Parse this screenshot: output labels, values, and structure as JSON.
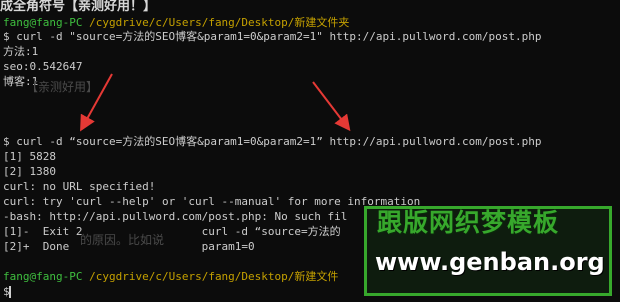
{
  "colors": {
    "background": "#0c0c0c",
    "text": "#cccccc",
    "prompt_user": "#3fbf3f",
    "prompt_host": "#bf3fbf",
    "prompt_path": "#c4a000",
    "arrow": "#e53935",
    "watermark_green": "#37a82c"
  },
  "ghost_text": {
    "top_banner": "成全角符号【亲测好用！】",
    "shadow_1": "【亲测好用】",
    "shadow_2": "的原因。比如说"
  },
  "terminal": {
    "block1": {
      "prompt_user": "fang@fang-PC",
      "prompt_path": "/cygdrive/c/Users/fang/Desktop/新建文件夹",
      "command": "$ curl -d \"source=方法的SEO博客&param1=0&param2=1\" http://api.pullword.com/post.php",
      "output": [
        "方法:1",
        "seo:0.542647",
        "博客:1"
      ]
    },
    "block2": {
      "command": "$ curl -d “source=方法的SEO博客&param1=0&param2=1” http://api.pullword.com/post.php",
      "output": [
        "[1] 5828",
        "[2] 1380",
        "curl: no URL specified!",
        "curl: try 'curl --help' or 'curl --manual' for more information",
        "-bash: http://api.pullword.com/post.php: No such fil",
        "[1]-  Exit 2                  curl -d “source=方法的",
        "[2]+  Done                    param1=0"
      ]
    },
    "block3": {
      "prompt_user": "fang@fang-PC",
      "prompt_path": "/cygdrive/c/Users/fang/Desktop/新建文件",
      "command": "$"
    }
  },
  "watermark": {
    "title": "跟版网织梦模板",
    "url": "www.genban.org"
  },
  "icons": {
    "arrow_left": "red-arrow-icon",
    "arrow_right": "red-arrow-icon"
  }
}
